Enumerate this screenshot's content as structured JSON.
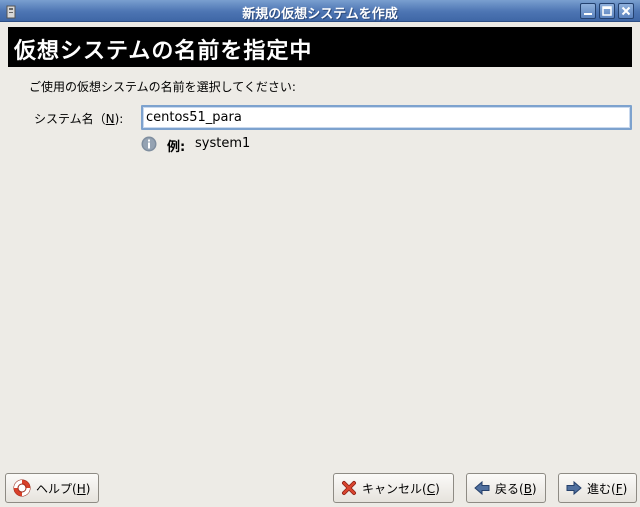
{
  "window": {
    "title": "新規の仮想システムを作成"
  },
  "header": {
    "title": "仮想システムの名前を指定中"
  },
  "form": {
    "instruction": "ご使用の仮想システムの名前を選択してください:",
    "name_label_prefix": "システム名（",
    "name_label_mnemonic": "N",
    "name_label_suffix": "):",
    "name_value": "centos51_para",
    "hint_prefix": "例:",
    "hint_example": "system1"
  },
  "buttons": {
    "help": {
      "label": "ヘルプ(",
      "mnemonic": "H",
      "suffix": ")",
      "icon": "lifebuoy-icon"
    },
    "cancel": {
      "label": "キャンセル(",
      "mnemonic": "C",
      "suffix": ")",
      "icon": "x-icon"
    },
    "back": {
      "label": "戻る(",
      "mnemonic": "B",
      "suffix": ")",
      "icon": "arrow-left-icon"
    },
    "forward": {
      "label": "進む(",
      "mnemonic": "F",
      "suffix": ")",
      "icon": "arrow-right-icon"
    }
  },
  "colors": {
    "titlebar": "#4d75b3",
    "header_band": "#000000",
    "background": "#edebe6",
    "field_focus_border": "#7da2ce"
  }
}
